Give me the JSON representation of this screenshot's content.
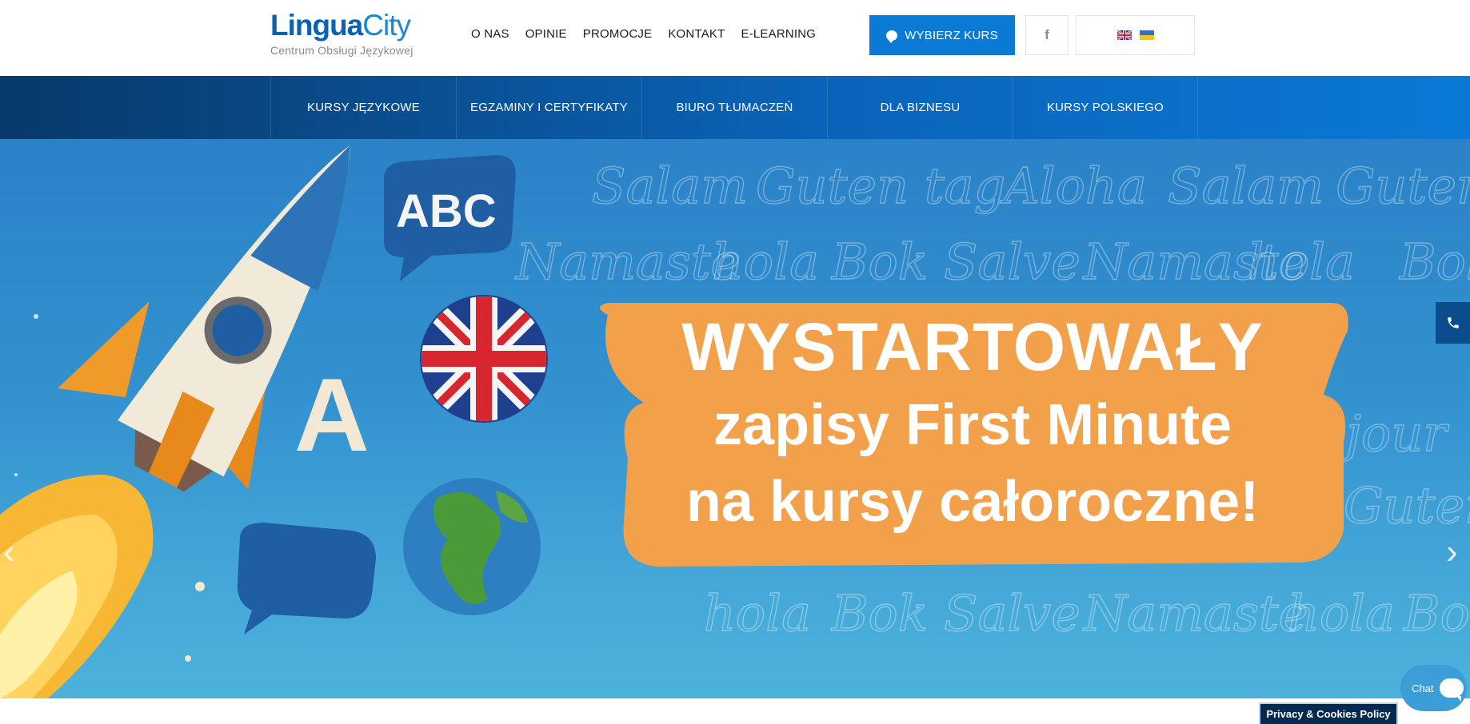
{
  "logo": {
    "part1": "Lingua",
    "part2": "City",
    "subtitle": "Centrum Obsługi Językowej"
  },
  "topnav": [
    "O NAS",
    "OPINIE",
    "PROMOCJE",
    "KONTAKT",
    "E-LEARNING"
  ],
  "cta": {
    "label": "WYBIERZ KURS",
    "icon": "chat-icon"
  },
  "social": {
    "icon": "facebook-icon",
    "glyph": "f"
  },
  "languages": [
    "en-flag-icon",
    "ua-flag-icon"
  ],
  "mainnav": [
    "KURSY JĘZYKOWE",
    "EGZAMINY I CERTYFIKATY",
    "BIURO TŁUMACZEŃ",
    "DLA BIZNESU",
    "KURSY POLSKIEGO"
  ],
  "hero": {
    "headline1": "WYSTARTOWAŁY",
    "headline2": "zapisy First Minute",
    "headline3": "na kursy całoroczne!",
    "abc": "ABC",
    "letter": "A",
    "background_words": [
      "Salam",
      "Guten tag",
      "Aloha",
      "Salam",
      "Guten",
      "Namaste",
      "hola",
      "Bok",
      "Salve",
      "Namaste",
      "hola",
      "Bok",
      "Bonjour",
      "Guten",
      "hola",
      "Bok",
      "Salve",
      "Namaste",
      "hola",
      "Bok"
    ],
    "prev_arrow": "‹",
    "next_arrow": "›"
  },
  "widgets": {
    "phone_icon": "phone-icon",
    "chat_label": "Chat",
    "privacy_label": "Privacy & Cookies Policy"
  },
  "colors": {
    "brand_blue": "#0a7ad4",
    "nav_dark": "#07396b",
    "orange": "#f2a04a",
    "hero_blue": "#3391cf"
  }
}
